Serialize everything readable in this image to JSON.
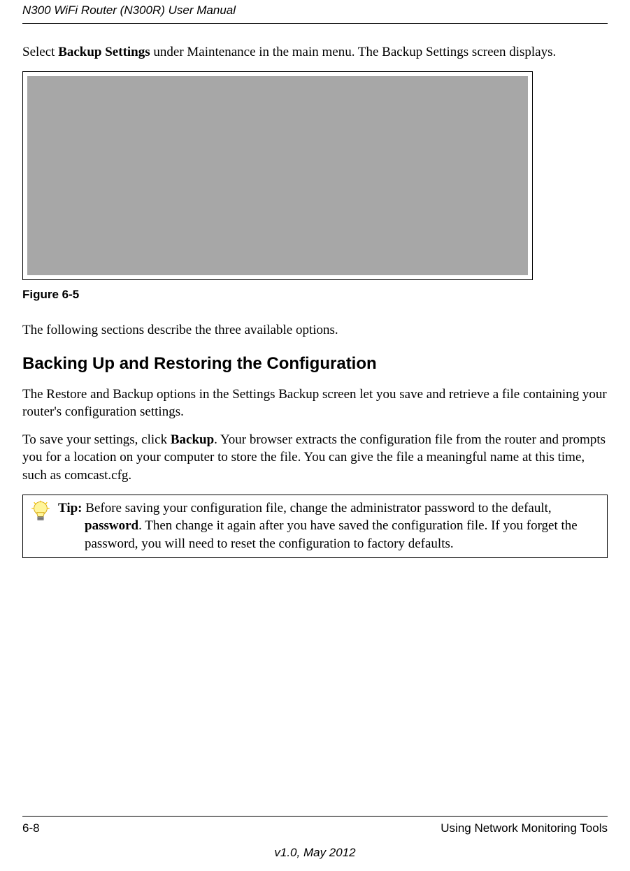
{
  "header": {
    "title": "N300 WiFi Router (N300R) User Manual"
  },
  "para1": {
    "pre": "Select ",
    "bold": "Backup Settings",
    "post": " under Maintenance in the main menu. The Backup Settings screen displays."
  },
  "figure_caption": "Figure 6-5",
  "para2": "The following sections describe the three available options.",
  "section_heading": "Backing Up and Restoring the Configuration",
  "para3": "The Restore and Backup options in the Settings Backup screen let you save and retrieve a file containing your router's configuration settings.",
  "para4": {
    "pre": "To save your settings, click ",
    "bold": "Backup",
    "post": ". Your browser extracts the configuration file from the router and prompts you for a location on your computer to store the file. You can give the file a meaningful name at this time, such as comcast.cfg."
  },
  "tip": {
    "label": "Tip:",
    "pre": " Before saving your configuration file, change the administrator password to the default, ",
    "bold": "password",
    "post": ". Then change it again after you have saved the configuration file. If you forget the password, you will need to reset the configuration to factory defaults."
  },
  "footer": {
    "page": "6-8",
    "section": "Using Network Monitoring Tools",
    "version": "v1.0, May 2012"
  }
}
